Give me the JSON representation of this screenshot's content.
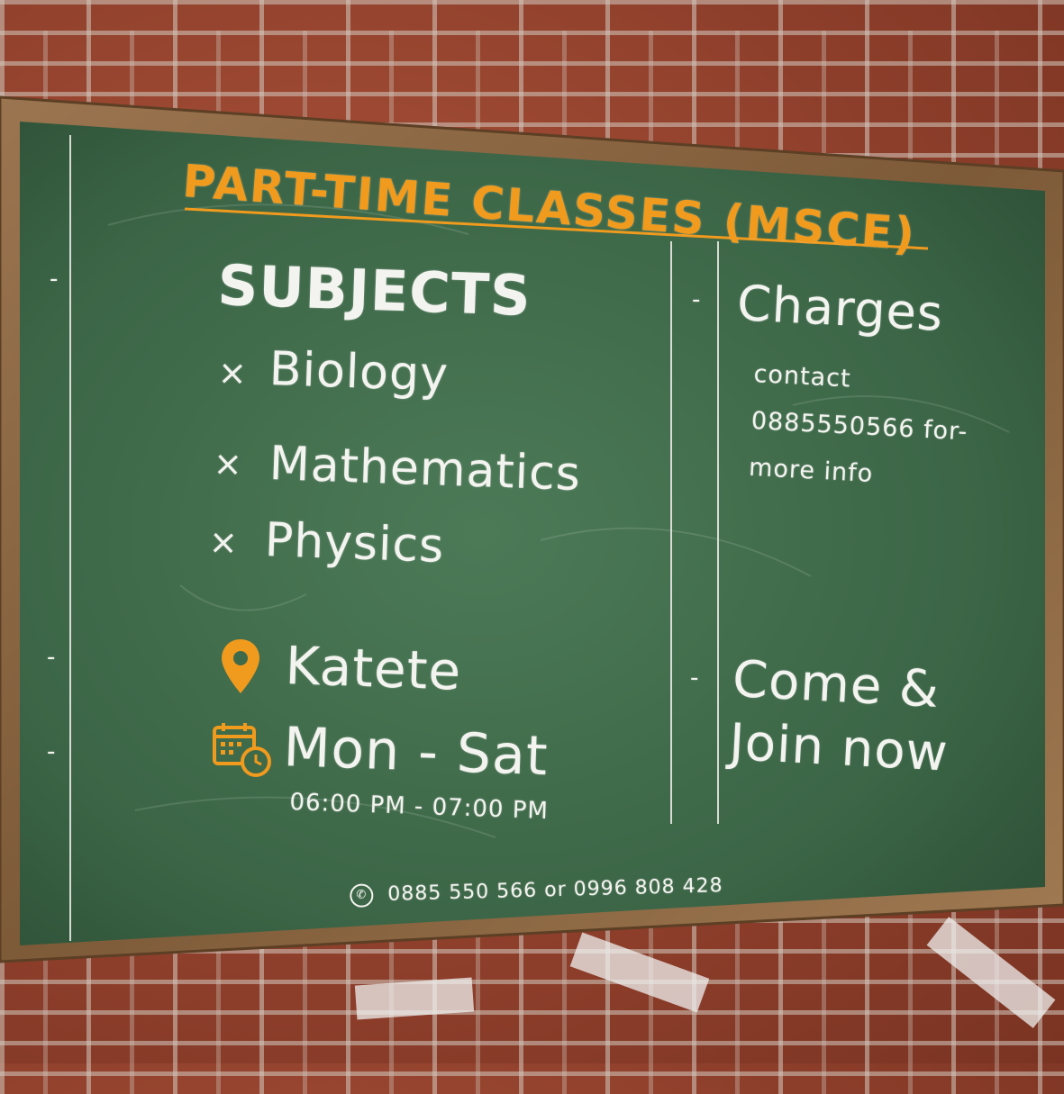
{
  "title": "PART-TIME CLASSES (MSCE)",
  "subjects": {
    "heading": "SUBJECTS",
    "marker": "×",
    "items": [
      "Biology",
      "Mathematics",
      "Physics"
    ]
  },
  "location": {
    "icon": "location-pin-icon",
    "text": "Katete"
  },
  "schedule": {
    "icon": "calendar-clock-icon",
    "days": "Mon - Sat",
    "times": "06:00 PM - 07:00 PM"
  },
  "charges": {
    "heading": "Charges",
    "body": "contact 0885550566 for-more info"
  },
  "cta": "Come & Join now",
  "contact": {
    "icon": "phone-icon",
    "text": "0885 550 566 or 0996 808 428"
  },
  "colors": {
    "board": "#3f6a4a",
    "frame": "#8a6440",
    "accent": "#f09a1e",
    "chalk": "#f3f3ef",
    "brick": "#9a4a34"
  }
}
